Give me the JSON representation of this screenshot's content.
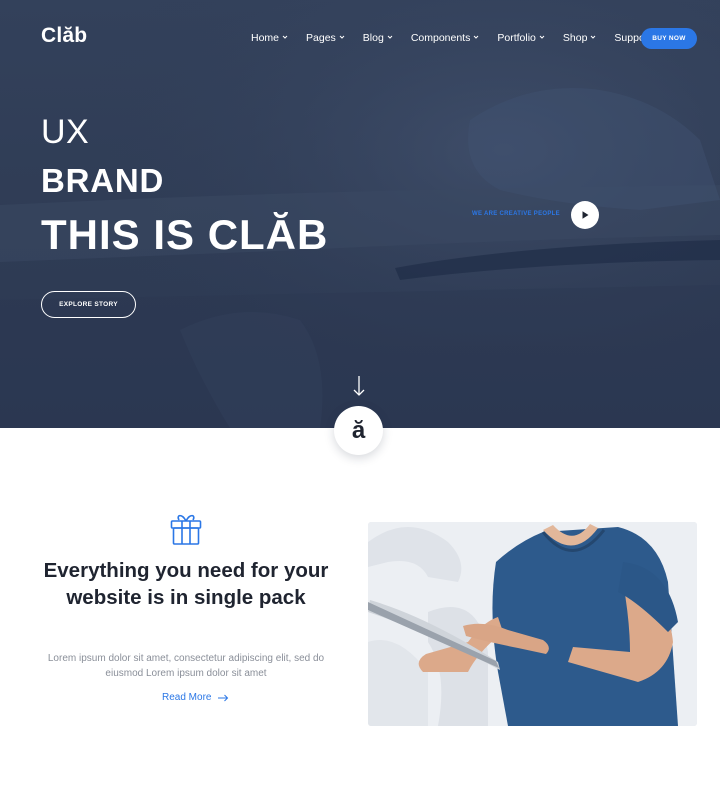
{
  "brand": {
    "logo": "Clăb"
  },
  "nav": {
    "items": [
      {
        "label": "Home"
      },
      {
        "label": "Pages"
      },
      {
        "label": "Blog"
      },
      {
        "label": "Components"
      },
      {
        "label": "Portfolio"
      },
      {
        "label": "Shop"
      },
      {
        "label": "Support"
      }
    ],
    "buy_label": "BUY NOW"
  },
  "hero": {
    "line1": "UX",
    "line2": "BRAND",
    "line3": "THIS IS CLĂB",
    "cta_label": "EXPLORE STORY",
    "creative_label": "WE ARE CREATIVE PEOPLE",
    "badge_letter": "ă"
  },
  "feature": {
    "title": "Everything you need for your website is in single pack",
    "text": "Lorem ipsum dolor sit amet, consectetur adipiscing elit, sed do eiusmod Lorem ipsum dolor sit amet",
    "read_more": "Read More"
  },
  "colors": {
    "hero_bg": "#2f3c55",
    "accent": "#2b77e6",
    "heading": "#1f2430",
    "muted_text": "#8a8f99"
  },
  "icons": [
    "chevron-down-icon",
    "play-icon",
    "arrow-down-icon",
    "gift-icon",
    "arrow-right-icon"
  ]
}
